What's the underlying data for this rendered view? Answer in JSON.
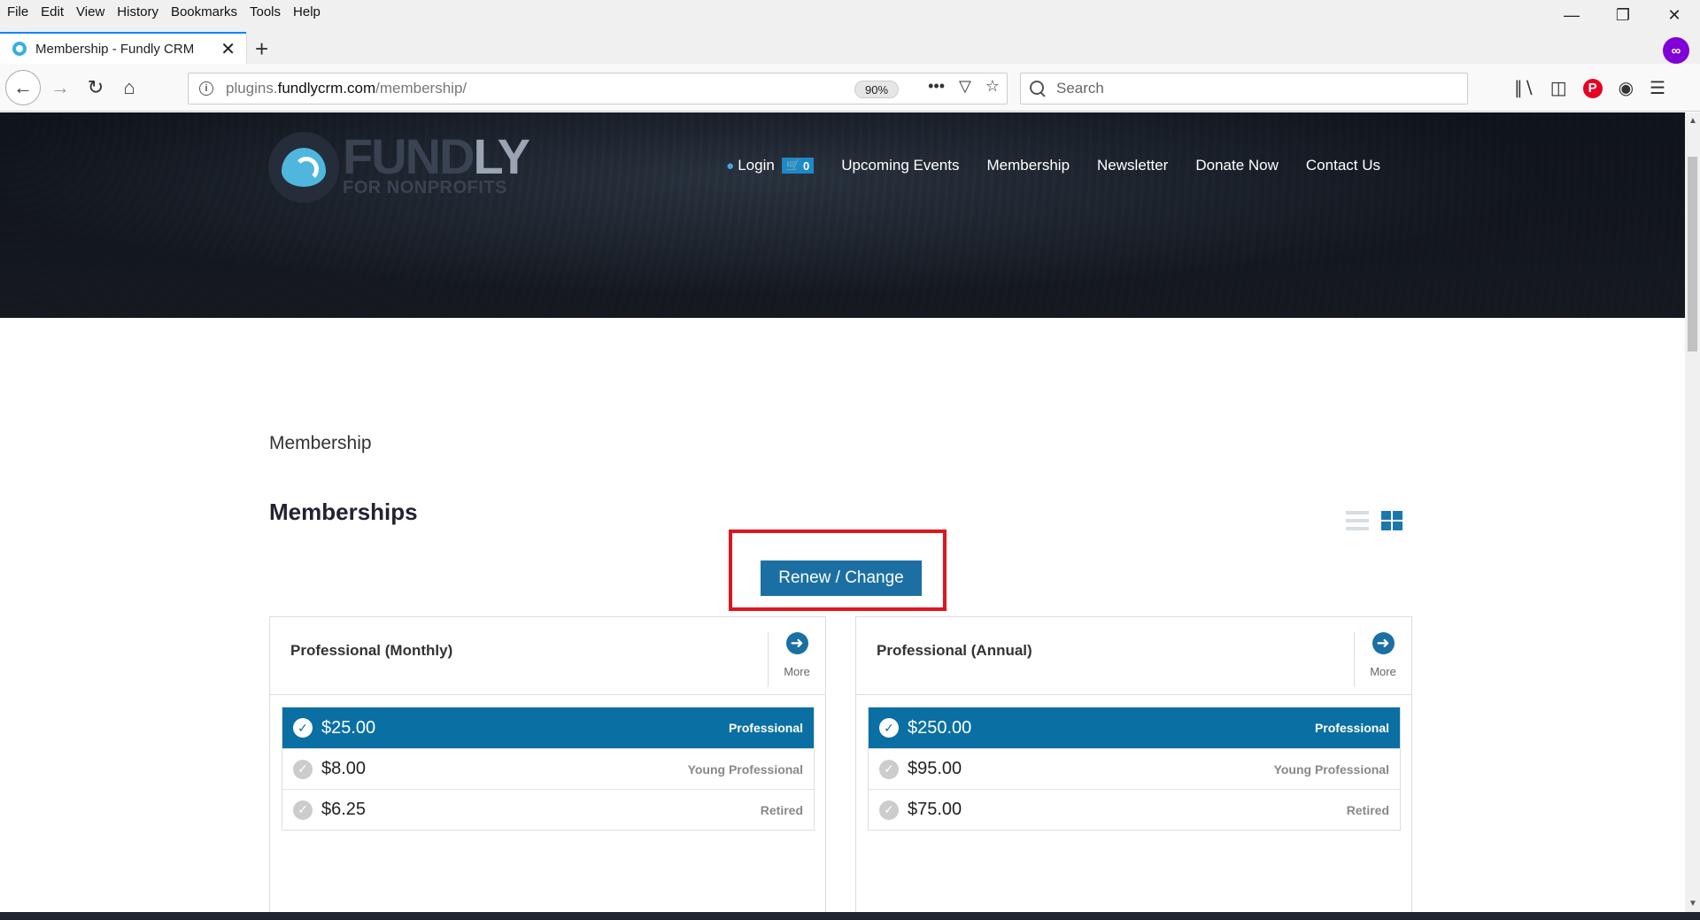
{
  "browser": {
    "menu": [
      "File",
      "Edit",
      "View",
      "History",
      "Bookmarks",
      "Tools",
      "Help"
    ],
    "tab_title": "Membership - Fundly CRM",
    "url_host": "plugins.",
    "url_domain": "fundlycrm.com",
    "url_path": "/membership/",
    "zoom": "90%",
    "search_placeholder": "Search"
  },
  "site": {
    "logo_name_a": "FUND",
    "logo_name_b": "LY",
    "logo_tagline": "FOR NONPROFITS",
    "nav": {
      "login": "Login",
      "cart_count": "0",
      "upcoming_events": "Upcoming Events",
      "membership": "Membership",
      "newsletter": "Newsletter",
      "donate_now": "Donate Now",
      "contact_us": "Contact Us"
    }
  },
  "page": {
    "breadcrumb_title": "Membership",
    "section_title": "Memberships",
    "renew_button": "Renew / Change",
    "more_label": "More",
    "cards": [
      {
        "title": "Professional (Monthly)",
        "prices": [
          {
            "amount": "$25.00",
            "tier": "Professional",
            "selected": true
          },
          {
            "amount": "$8.00",
            "tier": "Young Professional",
            "selected": false
          },
          {
            "amount": "$6.25",
            "tier": "Retired",
            "selected": false
          }
        ]
      },
      {
        "title": "Professional (Annual)",
        "prices": [
          {
            "amount": "$250.00",
            "tier": "Professional",
            "selected": true
          },
          {
            "amount": "$95.00",
            "tier": "Young Professional",
            "selected": false
          },
          {
            "amount": "$75.00",
            "tier": "Retired",
            "selected": false
          }
        ]
      }
    ]
  },
  "colors": {
    "accent": "#1b6fa3",
    "highlight": "#e0141e"
  }
}
